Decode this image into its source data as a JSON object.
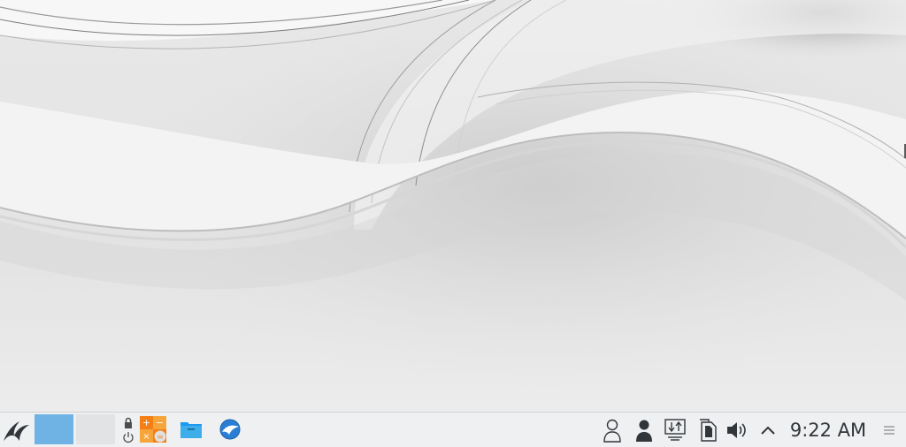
{
  "desktop": {
    "wallpaper": "grey-abstract-waves"
  },
  "panel": {
    "launcher_icon": "kde-app-launcher-icon",
    "pager": {
      "desktops": [
        {
          "active": true,
          "color": "#6fb3e4"
        },
        {
          "active": false,
          "color": "#e2e3e4"
        }
      ]
    },
    "session": {
      "lock_icon": "lock-icon",
      "power_icon": "power-icon"
    },
    "tasks": [
      {
        "icon": "calculator-icon",
        "color": "#f47f17"
      },
      {
        "icon": "folder-icon",
        "color": "#1d99f3"
      },
      {
        "icon": "web-browser-icon",
        "color": "#2a7fd4"
      }
    ],
    "tray": [
      {
        "icon": "user-outline-icon"
      },
      {
        "icon": "user-filled-icon"
      },
      {
        "icon": "network-transfer-icon"
      },
      {
        "icon": "clipboard-icon"
      },
      {
        "icon": "volume-icon"
      },
      {
        "icon": "chevron-up-icon"
      }
    ],
    "clock": "9:22 AM",
    "menu_icon": "hamburger-menu-icon"
  }
}
